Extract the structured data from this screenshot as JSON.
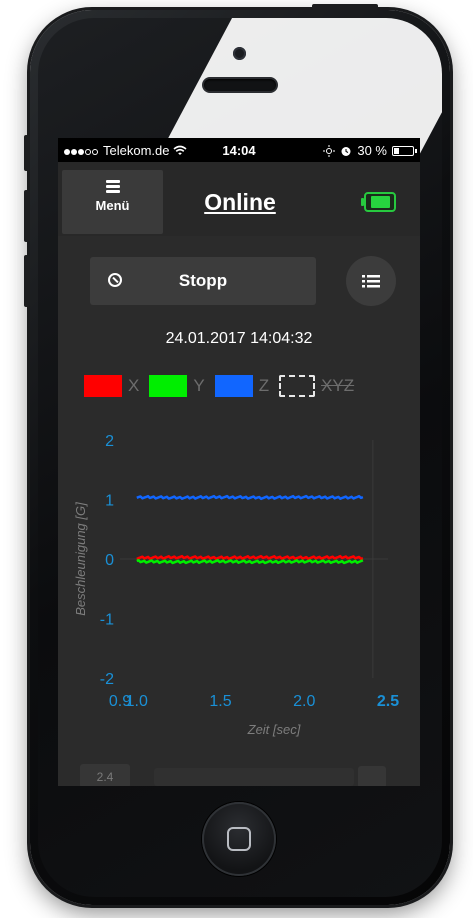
{
  "status_bar": {
    "carrier": "Telekom.de",
    "time": "14:04",
    "battery_percent": "30 %",
    "battery_level": 0.3,
    "icons": [
      "signal-dots-icon",
      "wifi-icon",
      "brightness-icon",
      "alarm-icon",
      "battery-icon"
    ]
  },
  "header": {
    "menu_label": "Menü",
    "title": "Online",
    "menu_icon": "hamburger-icon",
    "device_battery_icon": "battery-icon",
    "device_battery_color": "#27d33f"
  },
  "controls": {
    "stop_label": "Stopp",
    "stop_icon": "block-icon",
    "list_icon": "list-icon"
  },
  "timestamp": "24.01.2017 14:04:32",
  "legend": [
    {
      "label": "X",
      "color": "#ff0000"
    },
    {
      "label": "Y",
      "color": "#00ee00"
    },
    {
      "label": "Z",
      "color": "#1166ff"
    },
    {
      "label": "XYZ",
      "color": "",
      "style": "dashed",
      "disabled": true
    }
  ],
  "chart_data": {
    "type": "line",
    "ylabel": "Beschleunigung [G]",
    "xlabel": "Zeit [sec]",
    "ylim": [
      -2,
      2
    ],
    "xlim": [
      0.9,
      2.5
    ],
    "y_ticks": [
      "2",
      "1",
      "0",
      "-1",
      "-2"
    ],
    "x_ticks": [
      "0.9",
      "1.0",
      "1.5",
      "2.0",
      "2.5"
    ],
    "grid": false,
    "series": [
      {
        "name": "X",
        "color": "#ff0000",
        "x": [
          1.0,
          1.25,
          1.5,
          1.75,
          2.0,
          2.25,
          2.35
        ],
        "values": [
          0.02,
          0.03,
          0.02,
          0.03,
          0.02,
          0.03,
          0.02
        ]
      },
      {
        "name": "Y",
        "color": "#00ee00",
        "x": [
          1.0,
          1.25,
          1.5,
          1.75,
          2.0,
          2.25,
          2.35
        ],
        "values": [
          -0.04,
          -0.05,
          -0.04,
          -0.05,
          -0.04,
          -0.05,
          -0.04
        ]
      },
      {
        "name": "Z",
        "color": "#1166ff",
        "x": [
          1.0,
          1.25,
          1.5,
          1.75,
          2.0,
          2.25,
          2.35
        ],
        "values": [
          1.04,
          1.03,
          1.04,
          1.03,
          1.04,
          1.03,
          1.04
        ]
      }
    ]
  },
  "bottom": {
    "badge": "2.4"
  },
  "colors": {
    "screen_bg": "#2b2b2b",
    "axis_tick": "#1a90d6",
    "axis_label": "#7d7d7d"
  }
}
